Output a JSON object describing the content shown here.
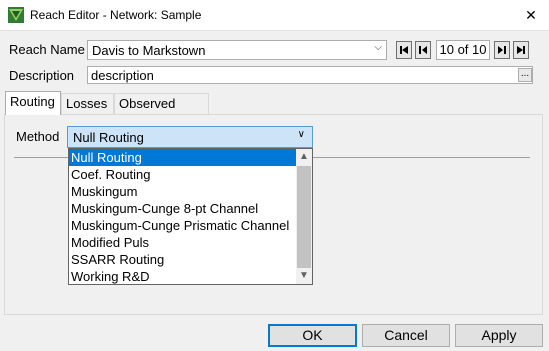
{
  "window": {
    "title": "Reach Editor - Network: Sample",
    "close_glyph": "✕"
  },
  "reach": {
    "label": "Reach Name",
    "value": "Davis to Markstown",
    "counter": "10 of 10"
  },
  "description": {
    "label": "Description",
    "value": "description",
    "ellipsis": "..."
  },
  "tabs": [
    {
      "label": "Routing"
    },
    {
      "label": "Losses"
    },
    {
      "label": "Observed Data"
    }
  ],
  "method": {
    "label": "Method",
    "value": "Null Routing",
    "options": [
      "Null Routing",
      "Coef. Routing",
      "Muskingum",
      "Muskingum-Cunge 8-pt Channel",
      "Muskingum-Cunge Prismatic Channel",
      "Modified Puls",
      "SSARR Routing",
      "Working R&D"
    ],
    "selected_index": 0
  },
  "buttons": {
    "ok": "OK",
    "cancel": "Cancel",
    "apply": "Apply"
  },
  "icons": [
    "app-icon",
    "close-icon",
    "chevron-down-icon",
    "first-record-icon",
    "previous-record-icon",
    "next-record-icon",
    "last-record-icon",
    "scroll-up-icon",
    "scroll-down-icon"
  ],
  "colors": {
    "accent": "#0078d7",
    "combo_focus_bg": "#cde3f7"
  }
}
